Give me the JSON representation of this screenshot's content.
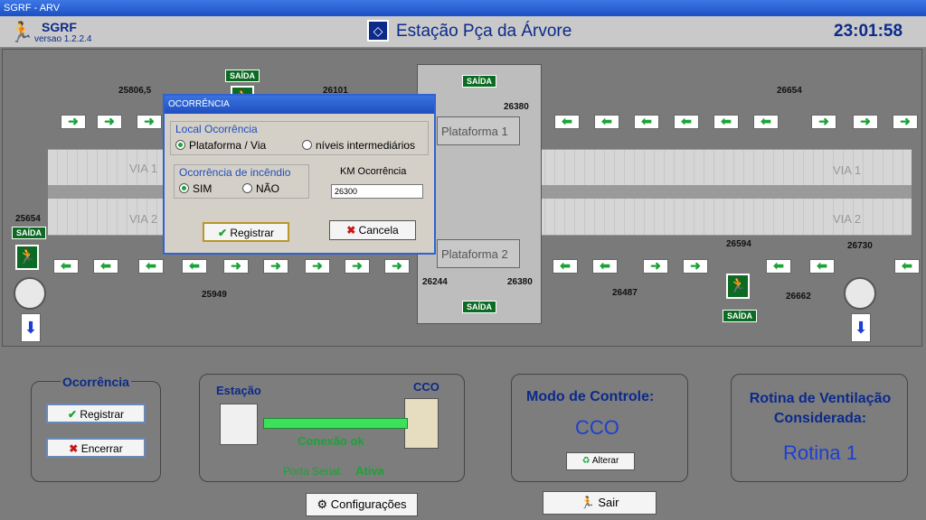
{
  "window": {
    "title": "SGRF - ARV"
  },
  "header": {
    "app_name": "SGRF",
    "version": "versao 1.2.2.4",
    "station": "Estação Pça da Árvore",
    "clock": "23:01:58"
  },
  "diagram": {
    "via1": "VIA 1",
    "via2": "VIA 2",
    "platform1": "Plataforma 1",
    "platform2": "Plataforma 2",
    "saida": "SAÍDA",
    "km_labels": [
      "25806,5",
      "26101",
      "26244",
      "26380",
      "26654",
      "25654",
      "25949",
      "26244",
      "26380",
      "26487",
      "26594",
      "26662",
      "26730"
    ]
  },
  "dialog": {
    "title": "OCORRÊNCIA",
    "local_label": "Local Ocorrência",
    "opt_plataforma": "Plataforma / Via",
    "opt_niveis": "níveis intermediários",
    "incendio_label": "Ocorrência de incêndio",
    "opt_sim": "SIM",
    "opt_nao": "NÃO",
    "km_label": "KM Ocorrência",
    "km_value": "26300",
    "registrar": "Registrar",
    "cancela": "Cancela"
  },
  "ocorrencia_panel": {
    "title": "Ocorrência",
    "registrar": "Registrar",
    "encerrar": "Encerrar"
  },
  "conexao_panel": {
    "estacao": "Estação",
    "cco": "CCO",
    "status": "Conexão ok",
    "porta_label": "Porta Serial:",
    "porta_value": "Ativa"
  },
  "modo_panel": {
    "title": "Modo de Controle:",
    "value": "CCO",
    "alterar": "Alterar"
  },
  "rotina_panel": {
    "title1": "Rotina de Ventilação",
    "title2": "Considerada:",
    "value": "Rotina 1"
  },
  "footer": {
    "configuracoes": "Configurações",
    "sair": "Sair"
  }
}
